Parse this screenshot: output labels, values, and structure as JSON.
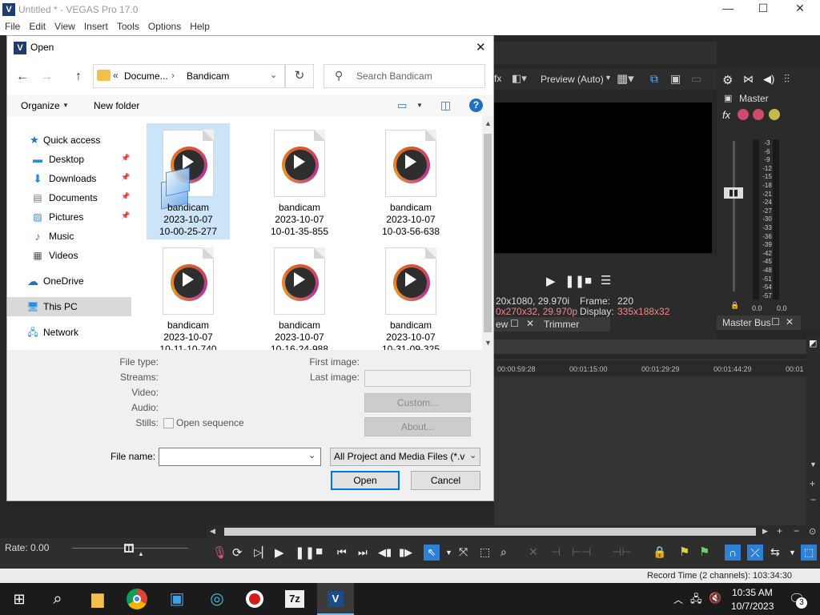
{
  "app": {
    "title": "Untitled * - VEGAS Pro 17.0",
    "logo": "V",
    "menu": [
      "File",
      "Edit",
      "View",
      "Insert",
      "Tools",
      "Options",
      "Help"
    ],
    "window_buttons": {
      "minimize": "—",
      "maximize": "☐",
      "close": "✕"
    }
  },
  "preview": {
    "mode_label": "Preview (Auto)",
    "info_left_1": "20x1080, 29.970i",
    "info_left_2": "0x270x32, 29.970p",
    "frame_label": "Frame:",
    "frame_value": "220",
    "display_label": "Display:",
    "display_value": "335x188x32",
    "tab_view": "ew",
    "tab_trimmer": "Trimmer"
  },
  "master": {
    "label": "Master",
    "fx_label": "fx",
    "meter_ticks": [
      "3",
      "6",
      "9",
      "12",
      "15",
      "18",
      "21",
      "24",
      "27",
      "30",
      "33",
      "36",
      "39",
      "42",
      "45",
      "48",
      "51",
      "54",
      "57"
    ],
    "value_left": "0.0",
    "value_right": "0.0",
    "bus_tab": "Master Bus"
  },
  "timeline": {
    "ruler": [
      "00:00:59:28",
      "00:01:15:00",
      "00:01:29:29",
      "00:01:44:29",
      "00:01"
    ]
  },
  "transport": {
    "rate_label": "Rate: 0.00"
  },
  "status": {
    "record_time": "Record Time (2 channels): 103:34:30"
  },
  "taskbar": {
    "time": "10:35 AM",
    "date": "10/7/2023",
    "notification_count": "3",
    "sevenzip": "7z",
    "vegas": "V"
  },
  "dialog": {
    "title": "Open",
    "logo": "V",
    "close": "✕",
    "breadcrumb": {
      "prefix": "«",
      "parent": "Docume...",
      "sep": "›",
      "current": "Bandicam"
    },
    "search_placeholder": "Search Bandicam",
    "organize": "Organize",
    "new_folder": "New folder",
    "help": "?",
    "nav": {
      "quick_access": "Quick access",
      "desktop": "Desktop",
      "downloads": "Downloads",
      "documents": "Documents",
      "pictures": "Pictures",
      "music": "Music",
      "videos": "Videos",
      "onedrive": "OneDrive",
      "this_pc": "This PC",
      "network": "Network"
    },
    "files": [
      {
        "name": "bandicam",
        "date": "2023-10-07",
        "time": "10-00-25-277"
      },
      {
        "name": "bandicam",
        "date": "2023-10-07",
        "time": "10-01-35-855"
      },
      {
        "name": "bandicam",
        "date": "2023-10-07",
        "time": "10-03-56-638"
      },
      {
        "name": "bandicam",
        "date": "2023-10-07",
        "time": "10-11-10-740"
      },
      {
        "name": "bandicam",
        "date": "2023-10-07",
        "time": "10-16-24-988"
      },
      {
        "name": "bandicam",
        "date": "2023-10-07",
        "time": "10-31-09-325"
      }
    ],
    "props": {
      "file_type": "File type:",
      "streams": "Streams:",
      "video": "Video:",
      "audio": "Audio:",
      "stills": "Stills:",
      "open_sequence": "Open sequence",
      "first_image": "First image:",
      "last_image": "Last image:",
      "custom": "Custom...",
      "about": "About..."
    },
    "file_name_label": "File name:",
    "file_name_value": "",
    "file_type_filter": "All Project and Media Files (*.ve",
    "open": "Open",
    "cancel": "Cancel"
  }
}
